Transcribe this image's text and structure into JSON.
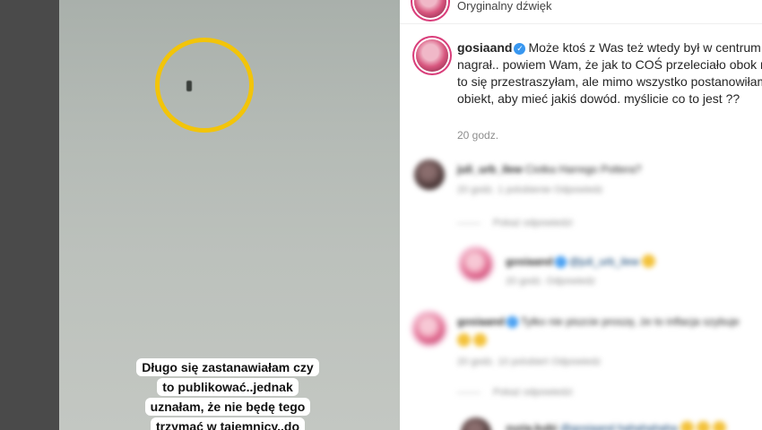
{
  "video": {
    "caption_lines": [
      "Długo się zastanawiałam czy",
      "to publikować..jednak",
      "uznałam, że nie będę tego",
      "trzymać w tajemnicy..do"
    ]
  },
  "header": {
    "sound_label": "Oryginalny dźwięk"
  },
  "post": {
    "username": "gosiaand",
    "text": "Może ktoś z Was też wtedy był w centrum W i to nagrał.. powiem Wam, że jak to COŚ przeleciało obok mojego okna to się przestraszyłam, ale mimo wszystko postanowiłam nagrać ten obiekt, aby mieć jakiś dowód. myślicie co to jest ??",
    "time": "20 godz."
  },
  "comments": [
    {
      "user": "juli_urb_ilew",
      "text": "Ciotka Harrego Pottera?",
      "meta": "20 godz.   1 polubienie   Odpowiedz",
      "replies": "Pokaż odpowiedzi"
    },
    {
      "user": "gosiaand",
      "text": "@juli_urb_ilew",
      "meta": "20 godz.   Odpowiedz"
    },
    {
      "user": "gosiaand",
      "text": "Tylko nie piszcie proszę, że to inflacja szybuje",
      "meta": "20 godz.   10 polubień   Odpowiedz",
      "replies": "Pokaż odpowiedzi"
    },
    {
      "user": "zuzia.kubi",
      "text": "@gosiaand hahahahaha"
    }
  ]
}
